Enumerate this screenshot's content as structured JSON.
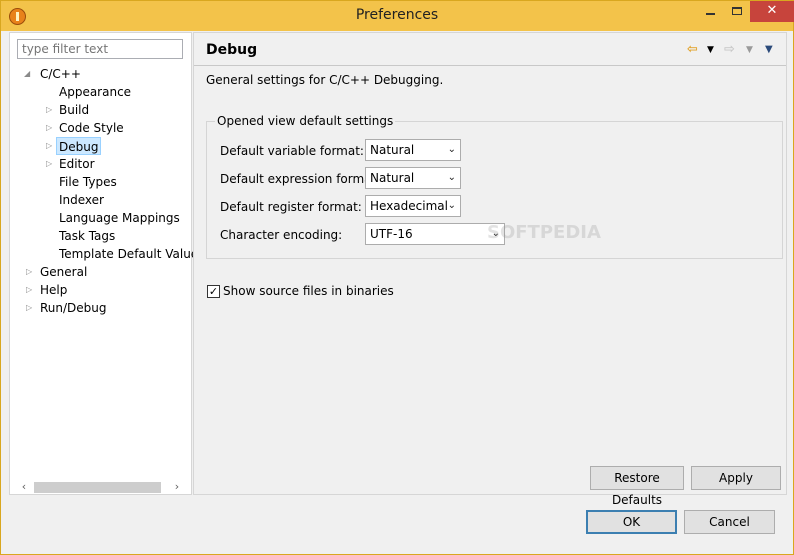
{
  "window": {
    "title": "Preferences"
  },
  "filter": {
    "placeholder": "type filter text"
  },
  "tree": {
    "cpp": "C/C++",
    "appearance": "Appearance",
    "build": "Build",
    "code_style": "Code Style",
    "debug": "Debug",
    "editor": "Editor",
    "file_types": "File Types",
    "indexer": "Indexer",
    "language_mappings": "Language Mappings",
    "task_tags": "Task Tags",
    "template_default_value": "Template Default Value",
    "general": "General",
    "help": "Help",
    "run_debug": "Run/Debug"
  },
  "page": {
    "title": "Debug",
    "description": "General settings for C/C++ Debugging.",
    "group_title": "Opened view default settings",
    "fields": {
      "variable_format_label": "Default variable format:",
      "variable_format_value": "Natural",
      "expression_format_label": "Default expression format:",
      "expression_format_value": "Natural",
      "register_format_label": "Default register format:",
      "register_format_value": "Hexadecimal",
      "encoding_label": "Character encoding:",
      "encoding_value": "UTF-16"
    },
    "show_source_label": "Show source files in binaries",
    "show_source_checked": true
  },
  "buttons": {
    "restore_defaults": "Restore Defaults",
    "apply": "Apply",
    "ok": "OK",
    "cancel": "Cancel"
  },
  "watermark": "SOFTPEDIA",
  "colors": {
    "titlebar": "#f3c34a",
    "close": "#c7443c",
    "selection": "#cce8ff",
    "nav_back": "#e2a32b"
  }
}
